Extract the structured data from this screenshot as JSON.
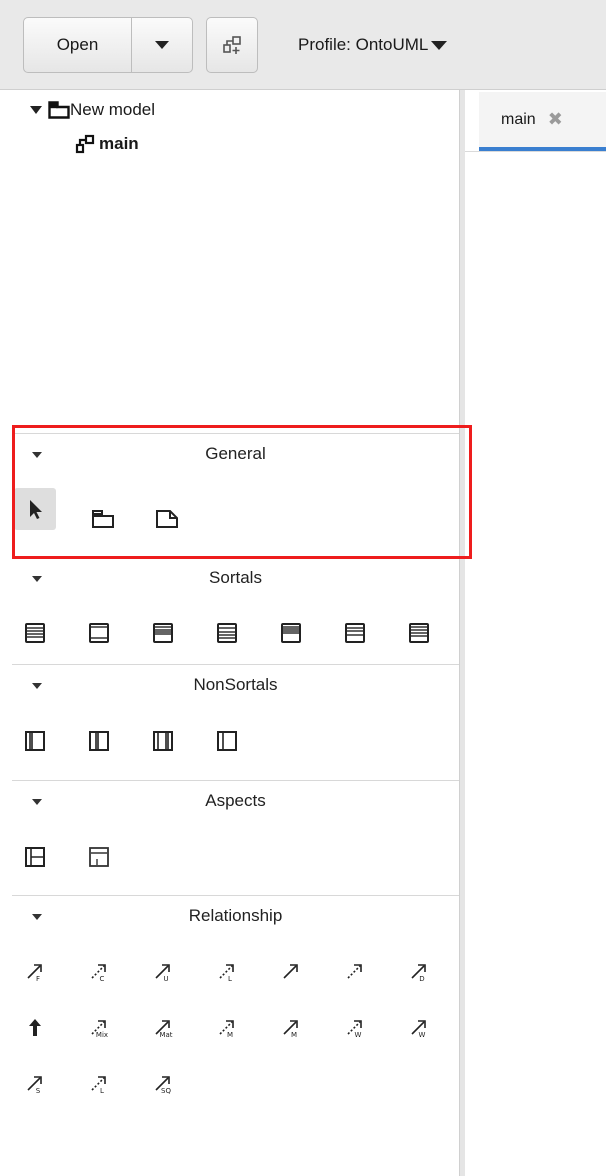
{
  "toolbar": {
    "open_label": "Open",
    "profile_label": "Profile: OntoUML"
  },
  "tree": {
    "root_label": "New model",
    "child_label": "main"
  },
  "editor": {
    "tab_label": "main",
    "tab_close_glyph": "✖"
  },
  "palette": {
    "general": {
      "title": "General",
      "tools": [
        "pointer-tool",
        "package-tool",
        "note-tool"
      ]
    },
    "sortals": {
      "title": "Sortals",
      "tools": [
        "kind",
        "collective",
        "quantity",
        "relator",
        "mode",
        "quality",
        "subkind"
      ]
    },
    "nonsortals": {
      "title": "NonSortals",
      "tools": [
        "category",
        "mixin",
        "role-mixin",
        "phase-mixin"
      ]
    },
    "aspects": {
      "title": "Aspects",
      "tools": [
        "event",
        "situation"
      ]
    },
    "relationship": {
      "title": "Relationship",
      "rows": [
        [
          "F",
          "C",
          "U",
          "L",
          "",
          "",
          "D"
        ],
        [
          "",
          "Mix",
          "Mat",
          "M",
          "M",
          "W",
          "W"
        ],
        [
          "S",
          "L",
          "SQ"
        ]
      ]
    }
  },
  "colors": {
    "highlight": "#ee1d1d",
    "tab_accent": "#3a7fd0",
    "toolbar_bg": "#e9e9e9"
  }
}
